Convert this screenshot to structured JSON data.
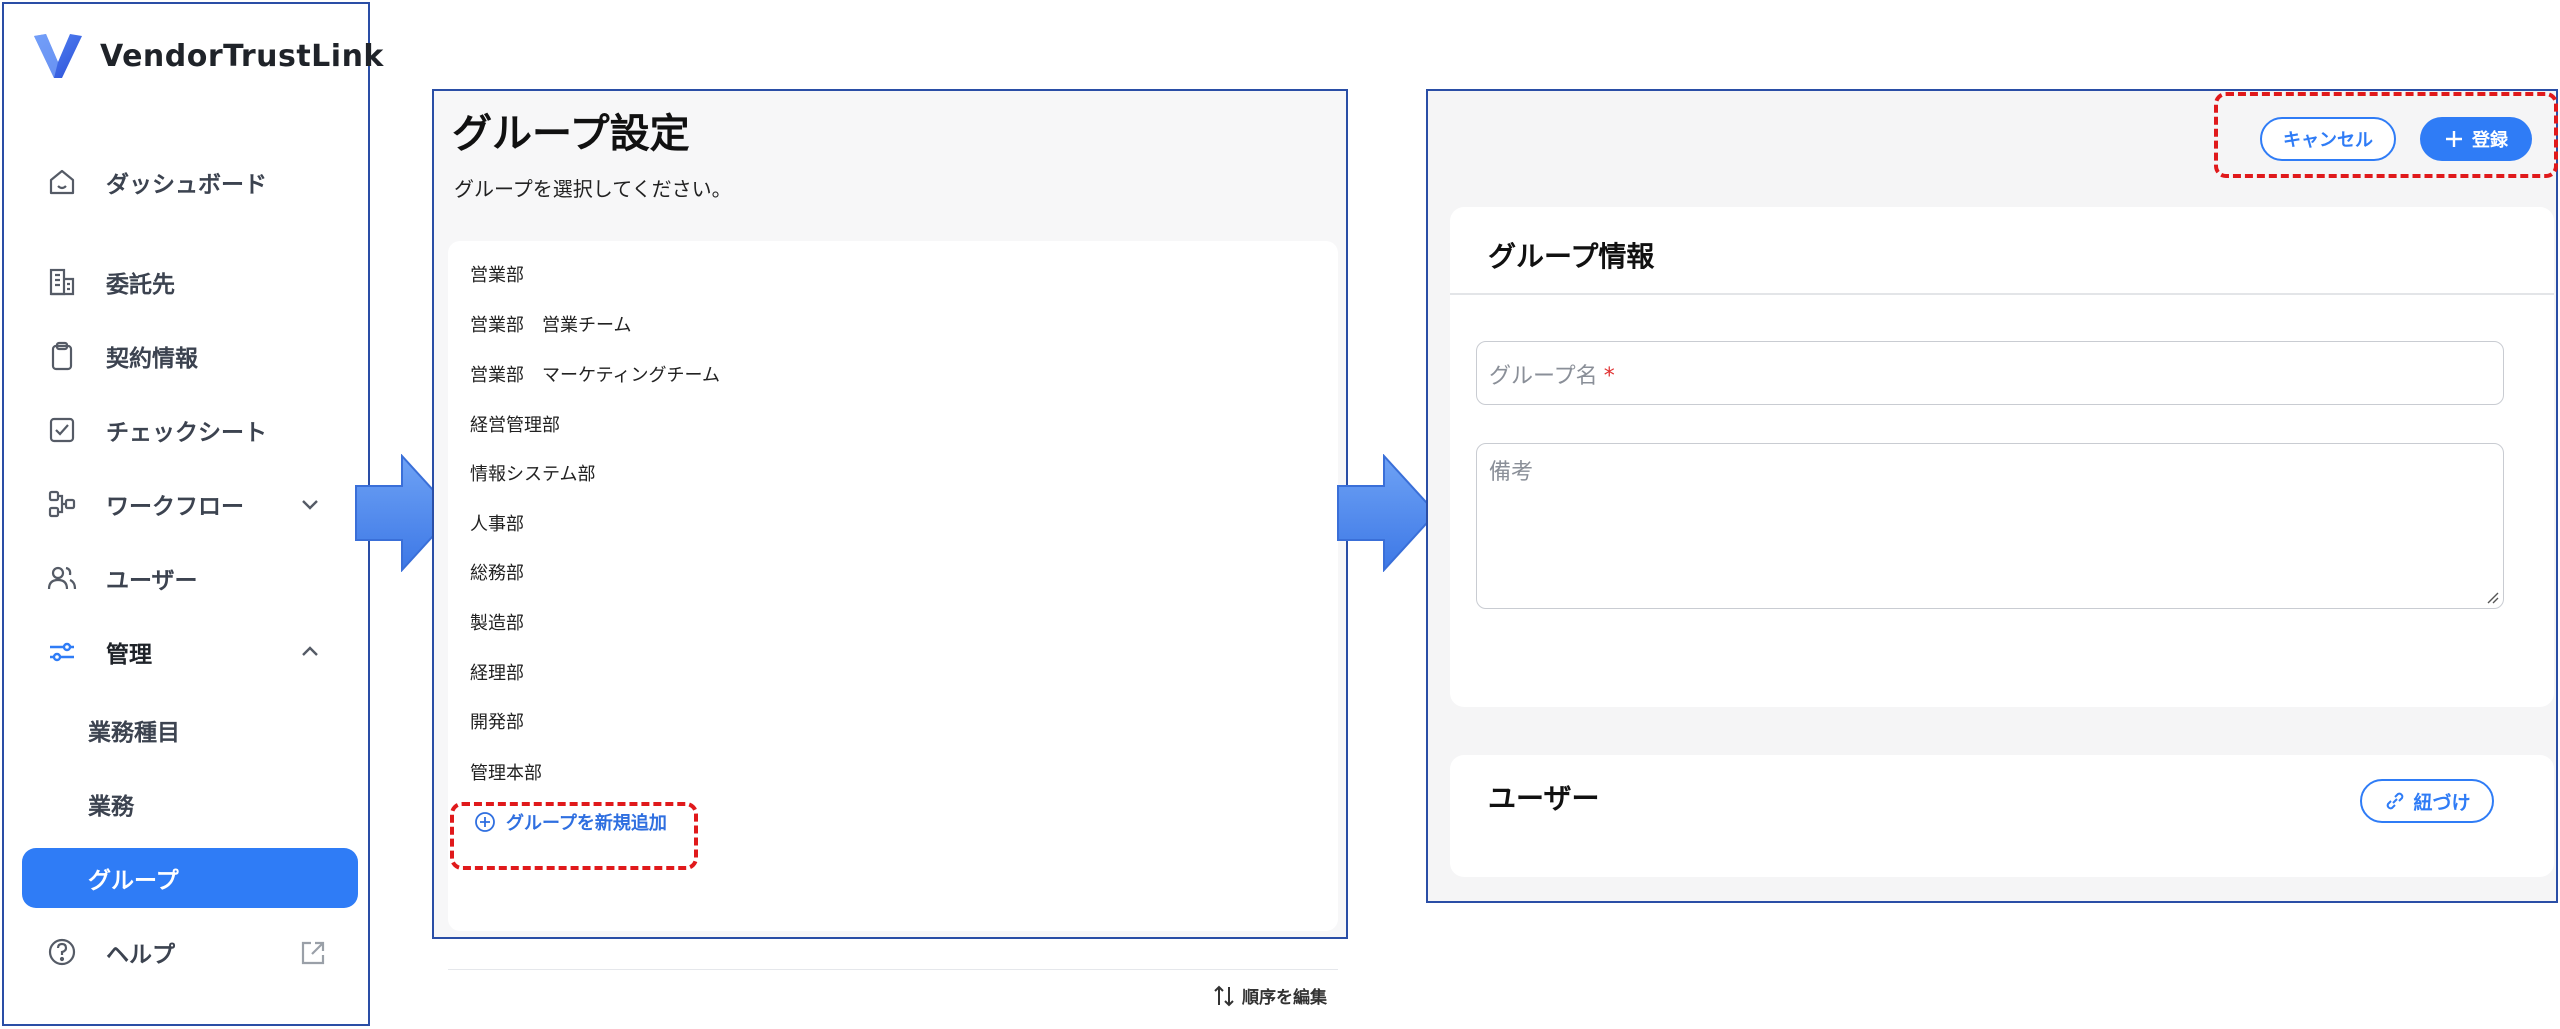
{
  "app": {
    "name": "VendorTrustLink"
  },
  "sidebar": {
    "items": [
      {
        "label": "ダッシュボード"
      },
      {
        "label": "委託先"
      },
      {
        "label": "契約情報"
      },
      {
        "label": "チェックシート"
      },
      {
        "label": "ワークフロー"
      },
      {
        "label": "ユーザー"
      },
      {
        "label": "管理"
      }
    ],
    "admin_subitems": [
      {
        "label": "業務種目"
      },
      {
        "label": "業務"
      },
      {
        "label": "グループ"
      }
    ],
    "help_label": "ヘルプ"
  },
  "group_settings": {
    "title": "グループ設定",
    "subtitle": "グループを選択してください。",
    "groups": [
      "営業部",
      "営業部　営業チーム",
      "営業部　マーケティングチーム",
      "経営管理部",
      "情報システム部",
      "人事部",
      "総務部",
      "製造部",
      "経理部",
      "開発部",
      "管理本部"
    ],
    "add_label": "グループを新規追加",
    "reorder_label": "順序を編集"
  },
  "group_form": {
    "cancel_label": "キャンセル",
    "register_label": "登録",
    "info_title": "グループ情報",
    "name_placeholder": "グループ名",
    "required_mark": "*",
    "note_placeholder": "備考",
    "users_title": "ユーザー",
    "link_label": "紐づけ"
  },
  "colors": {
    "accent": "#2f7cf6",
    "panel_border": "#2a4ea6",
    "highlight": "#e0191b",
    "arrow": "#4f8df0"
  }
}
